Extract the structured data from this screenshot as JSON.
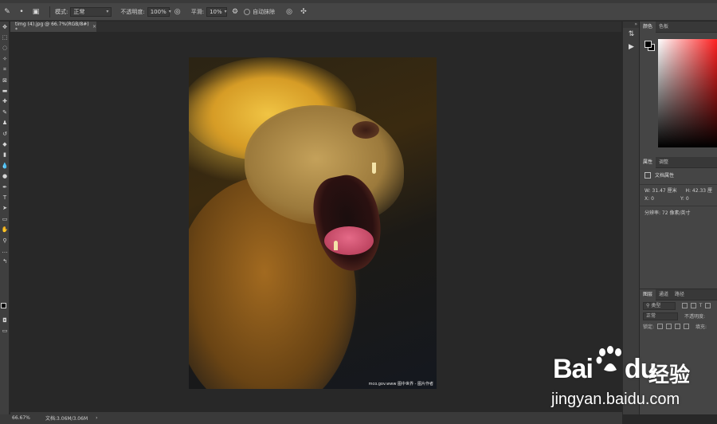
{
  "options_bar": {
    "mode_label": "模式:",
    "mode_value": "正常",
    "opacity_label": "不透明度:",
    "opacity_value": "100%",
    "smoothing_label": "平滑:",
    "smoothing_value": "10%",
    "auto_erase_label": "自动抹除"
  },
  "document": {
    "tab_title": "timg (4).jpg @ 66.7%(RGB/8#) *",
    "close_glyph": "×",
    "watermark": "mco.gov.www 图中世界 - 图片作者"
  },
  "status_bar": {
    "zoom": "66.67%",
    "doc_size": "文档:3.06M/3.06M",
    "arrow": "›"
  },
  "panels": {
    "color_tabs": [
      "颜色",
      "色板"
    ],
    "properties_tabs": [
      "属性",
      "调整"
    ],
    "doc_props_title": "文档属性",
    "w_label": "W:",
    "w_value": "31.47 厘米",
    "h_label": "H:",
    "h_value": "42.33 厘",
    "x_label": "X:",
    "x_value": "0",
    "y_label": "Y:",
    "y_value": "0",
    "resolution": "分辨率: 72 像素/英寸",
    "layer_tabs": [
      "图层",
      "通道",
      "路径"
    ],
    "layer_kind": "类型",
    "layer_blend": "正常",
    "layer_opacity": "不透明度:",
    "layer_lock": "锁定:",
    "layer_fill": "填充:"
  },
  "watermark": {
    "brand": "Bai",
    "brand_suffix": "du",
    "product": "经验",
    "url": "jingyan.baidu.com"
  },
  "colors": {
    "foreground": "#000000",
    "background": "#ffffff",
    "hue": "#ff2020"
  }
}
